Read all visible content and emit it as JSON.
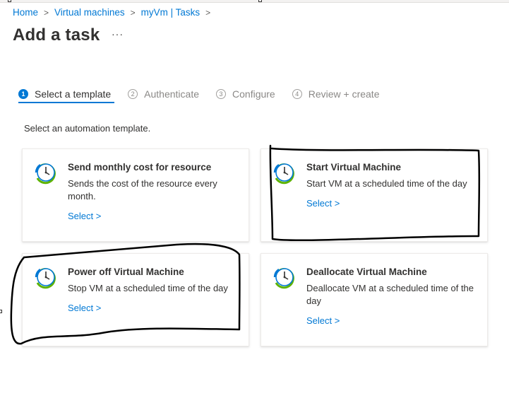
{
  "breadcrumb": [
    {
      "label": "Home"
    },
    {
      "label": "Virtual machines"
    },
    {
      "label": "myVm | Tasks"
    }
  ],
  "breadcrumb_separator": ">",
  "page": {
    "title": "Add a task",
    "more_label": "···"
  },
  "wizard": {
    "steps": [
      {
        "number": "1",
        "label": "Select a template",
        "active": true
      },
      {
        "number": "2",
        "label": "Authenticate",
        "active": false
      },
      {
        "number": "3",
        "label": "Configure",
        "active": false
      },
      {
        "number": "4",
        "label": "Review + create",
        "active": false
      }
    ]
  },
  "intro": "Select an automation template.",
  "templates": [
    {
      "title": "Send monthly cost for resource",
      "description": "Sends the cost of the resource every month.",
      "select_label": "Select >",
      "icon": "clock-icon"
    },
    {
      "title": "Start Virtual Machine",
      "description": "Start VM at a scheduled time of the day",
      "select_label": "Select >",
      "icon": "clock-icon"
    },
    {
      "title": "Power off Virtual Machine",
      "description": "Stop VM at a scheduled time of the day",
      "select_label": "Select >",
      "icon": "clock-icon"
    },
    {
      "title": "Deallocate Virtual Machine",
      "description": "Deallocate VM at a scheduled time of the day",
      "select_label": "Select >",
      "icon": "clock-icon"
    }
  ],
  "colors": {
    "accent": "#0078d4",
    "text": "#323130",
    "muted": "#8a8886",
    "annotation_ink": "#000000"
  }
}
